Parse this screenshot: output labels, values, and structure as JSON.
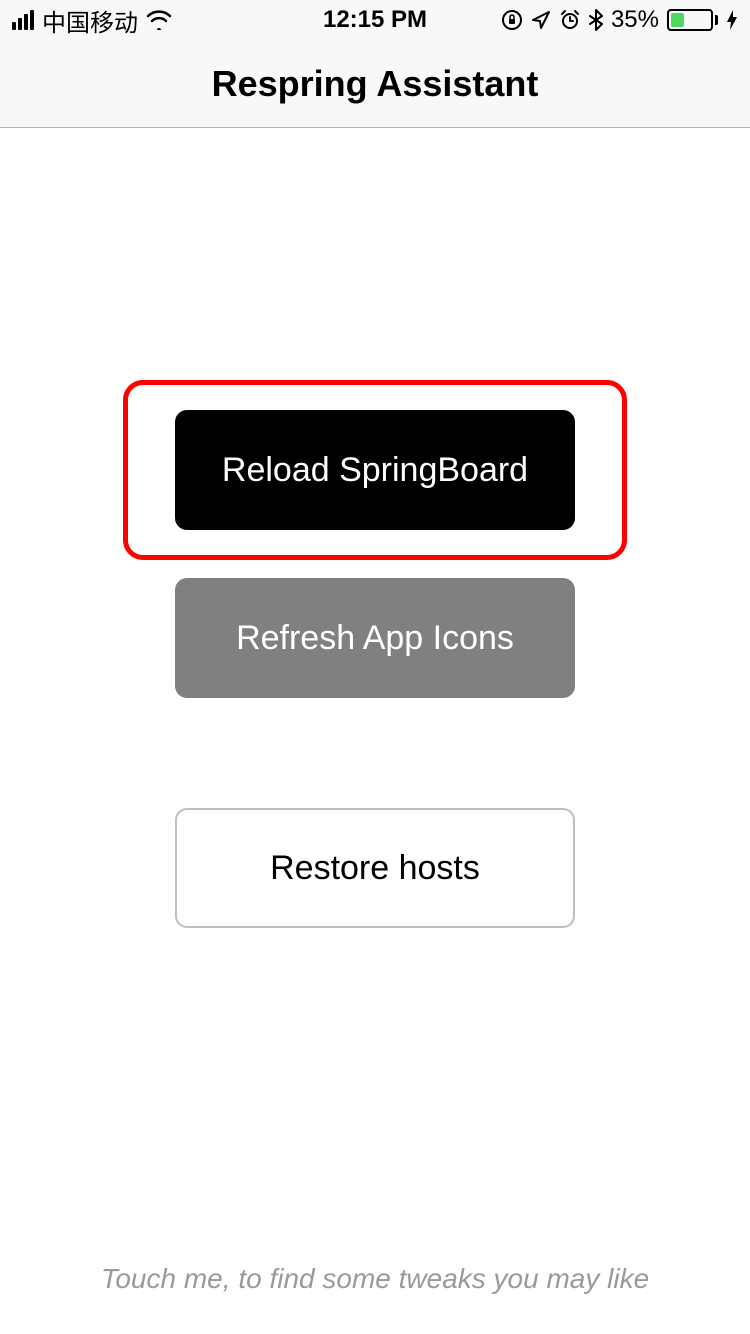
{
  "statusBar": {
    "carrier": "中国移动",
    "time": "12:15 PM",
    "batteryPercent": "35%",
    "batteryLevel": 35,
    "batteryColor": "#4cd964"
  },
  "nav": {
    "title": "Respring Assistant"
  },
  "buttons": {
    "reload": "Reload SpringBoard",
    "refresh": "Refresh App Icons",
    "restore": "Restore hosts"
  },
  "footer": {
    "hint": "Touch me, to find some tweaks you may like"
  }
}
